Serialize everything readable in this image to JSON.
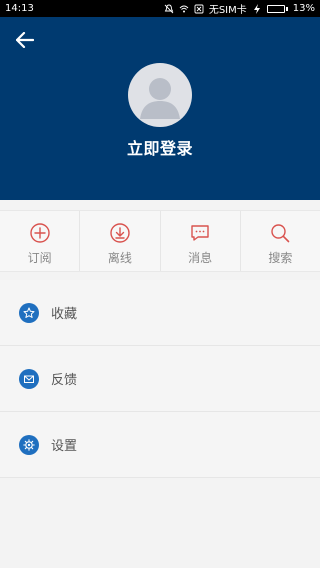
{
  "status_bar": {
    "time": "14:13",
    "carrier": "无SIM卡",
    "battery_percent": "13%",
    "battery_level": 0.13
  },
  "header": {
    "back_icon": "arrow-left-icon",
    "avatar_icon": "default-avatar-icon",
    "login_label": "立即登录",
    "background_color": "#003a70"
  },
  "actions": [
    {
      "label": "订阅",
      "icon": "plus-circle-icon"
    },
    {
      "label": "离线",
      "icon": "download-circle-icon"
    },
    {
      "label": "消息",
      "icon": "message-icon"
    },
    {
      "label": "搜索",
      "icon": "search-icon"
    }
  ],
  "menu": [
    {
      "label": "收藏",
      "icon": "star-icon"
    },
    {
      "label": "反馈",
      "icon": "mail-icon"
    },
    {
      "label": "设置",
      "icon": "gear-icon"
    }
  ],
  "colors": {
    "accent_red": "#d9534f",
    "list_icon_blue": "#1f6fbf"
  }
}
